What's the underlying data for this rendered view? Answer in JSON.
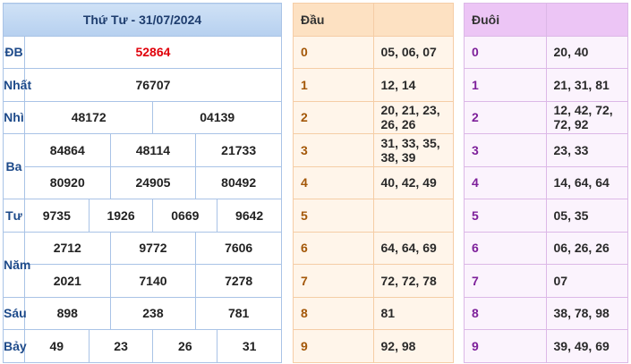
{
  "main": {
    "title": "Thứ Tư - 31/07/2024",
    "labels": {
      "db": "ĐB",
      "nhat": "Nhất",
      "nhi": "Nhì",
      "ba": "Ba",
      "tu": "Tư",
      "nam": "Năm",
      "sau": "Sáu",
      "bay": "Bảy"
    },
    "db": [
      "52864"
    ],
    "nhat": [
      "76707"
    ],
    "nhi": [
      "48172",
      "04139"
    ],
    "ba": [
      "84864",
      "48114",
      "21733",
      "80920",
      "24905",
      "80492"
    ],
    "tu": [
      "9735",
      "1926",
      "0669",
      "9642"
    ],
    "nam": [
      "2712",
      "9772",
      "7606",
      "2021",
      "7140",
      "7278"
    ],
    "sau": [
      "898",
      "238",
      "781"
    ],
    "bay": [
      "49",
      "23",
      "26",
      "31"
    ]
  },
  "dau": {
    "title": "Đầu",
    "rows": [
      {
        "digit": "0",
        "values": "05, 06, 07"
      },
      {
        "digit": "1",
        "values": "12, 14"
      },
      {
        "digit": "2",
        "values": "20, 21, 23, 26, 26"
      },
      {
        "digit": "3",
        "values": "31, 33, 35, 38, 39"
      },
      {
        "digit": "4",
        "values": "40, 42, 49"
      },
      {
        "digit": "5",
        "values": ""
      },
      {
        "digit": "6",
        "values": "64, 64, 69"
      },
      {
        "digit": "7",
        "values": "72, 72, 78"
      },
      {
        "digit": "8",
        "values": "81"
      },
      {
        "digit": "9",
        "values": "92, 98"
      }
    ]
  },
  "duoi": {
    "title": "Đuôi",
    "rows": [
      {
        "digit": "0",
        "values": "20, 40"
      },
      {
        "digit": "1",
        "values": "21, 31, 81"
      },
      {
        "digit": "2",
        "values": "12, 42, 72, 72, 92"
      },
      {
        "digit": "3",
        "values": "23, 33"
      },
      {
        "digit": "4",
        "values": "14, 64, 64"
      },
      {
        "digit": "5",
        "values": "05, 35"
      },
      {
        "digit": "6",
        "values": "06, 26, 26"
      },
      {
        "digit": "7",
        "values": "07"
      },
      {
        "digit": "8",
        "values": "38, 78, 98"
      },
      {
        "digit": "9",
        "values": "39, 49, 69"
      }
    ]
  }
}
